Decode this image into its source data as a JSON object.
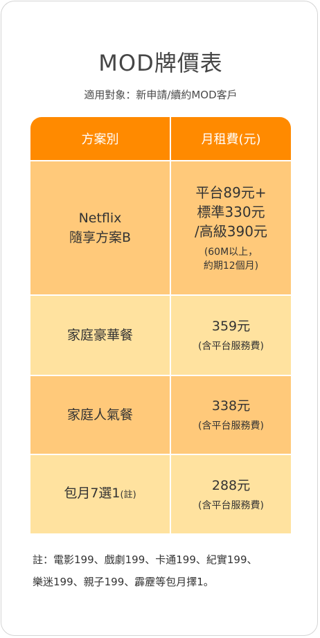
{
  "title": "MOD牌價表",
  "subtitle": "適用對象：新申請/續約MOD客戶",
  "table": {
    "headers": [
      "方案別",
      "月租費(元)"
    ],
    "rows": [
      {
        "plan_line1": "Netflix",
        "plan_line2": "隨享方案B",
        "price_lines": [
          "平台89元+",
          "標準330元",
          "/高級390元"
        ],
        "note_lines": [
          "(60M以上，",
          "約期12個月)"
        ]
      },
      {
        "plan": "家庭豪華餐",
        "price": "359元",
        "note": "(含平台服務費)"
      },
      {
        "plan": "家庭人氣餐",
        "price": "338元",
        "note": "(含平台服務費)"
      },
      {
        "plan": "包月7選1",
        "plan_suffix": "(註)",
        "price": "288元",
        "note": "(含平台服務費)"
      }
    ]
  },
  "footnote": {
    "line1": "註：電影199、戲劇199、卡通199、紀實199、",
    "line2": "樂迷199、親子199、霹靂等包月擇1。"
  },
  "colors": {
    "header": "#ff8a00",
    "row_dark": "#ffc97a",
    "row_light": "#ffe29f"
  }
}
